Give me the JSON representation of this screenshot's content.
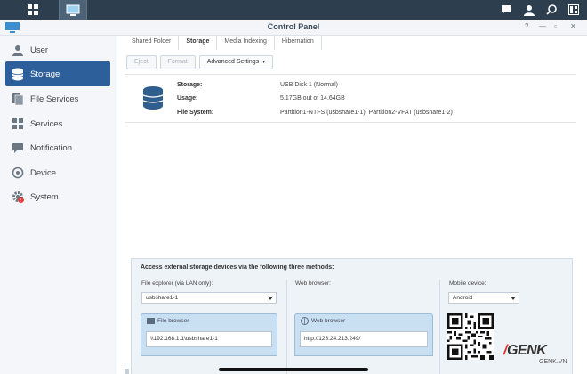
{
  "window": {
    "title": "Control Panel"
  },
  "sidebar": {
    "items": [
      {
        "label": "User",
        "icon": "user-icon"
      },
      {
        "label": "Storage",
        "icon": "storage-icon",
        "active": true
      },
      {
        "label": "File Services",
        "icon": "file-services-icon"
      },
      {
        "label": "Services",
        "icon": "services-icon"
      },
      {
        "label": "Notification",
        "icon": "notification-icon"
      },
      {
        "label": "Device",
        "icon": "device-icon"
      },
      {
        "label": "System",
        "icon": "system-icon"
      }
    ]
  },
  "tabs": [
    {
      "label": "Shared Folder"
    },
    {
      "label": "Storage",
      "active": true
    },
    {
      "label": "Media Indexing"
    },
    {
      "label": "Hibernation"
    }
  ],
  "toolbar": {
    "eject_label": "Eject",
    "format_label": "Format",
    "advanced_label": "Advanced Settings"
  },
  "info": {
    "storage_label": "Storage:",
    "storage_value": "USB Disk 1 (Normal)",
    "usage_label": "Usage:",
    "usage_value": "5.17GB out of 14.64GB",
    "fs_label": "File System:",
    "fs_value": "Partition1-NTFS (usbshare1-1), Partition2-VFAT (usbshare1-2)"
  },
  "access": {
    "title": "Access external storage devices via the following three methods:",
    "file_explorer_label": "File explorer (via LAN only):",
    "file_explorer_value": "usbshare1-1",
    "file_browser_label": "File browser",
    "file_browser_value": "\\\\192.168.1.1\\usbshare1-1",
    "web_browser_label": "Web browser:",
    "web_browser_tab": "Web browser",
    "web_browser_value": "http://123.24.213.249/",
    "mobile_label": "Mobile device:",
    "mobile_value": "Android"
  },
  "watermark": {
    "brand": "GENK",
    "url": "GENK.VN"
  },
  "colors": {
    "active": "#2d5f9a",
    "topbar": "#2d3e4f",
    "panel": "#eef3f8"
  }
}
